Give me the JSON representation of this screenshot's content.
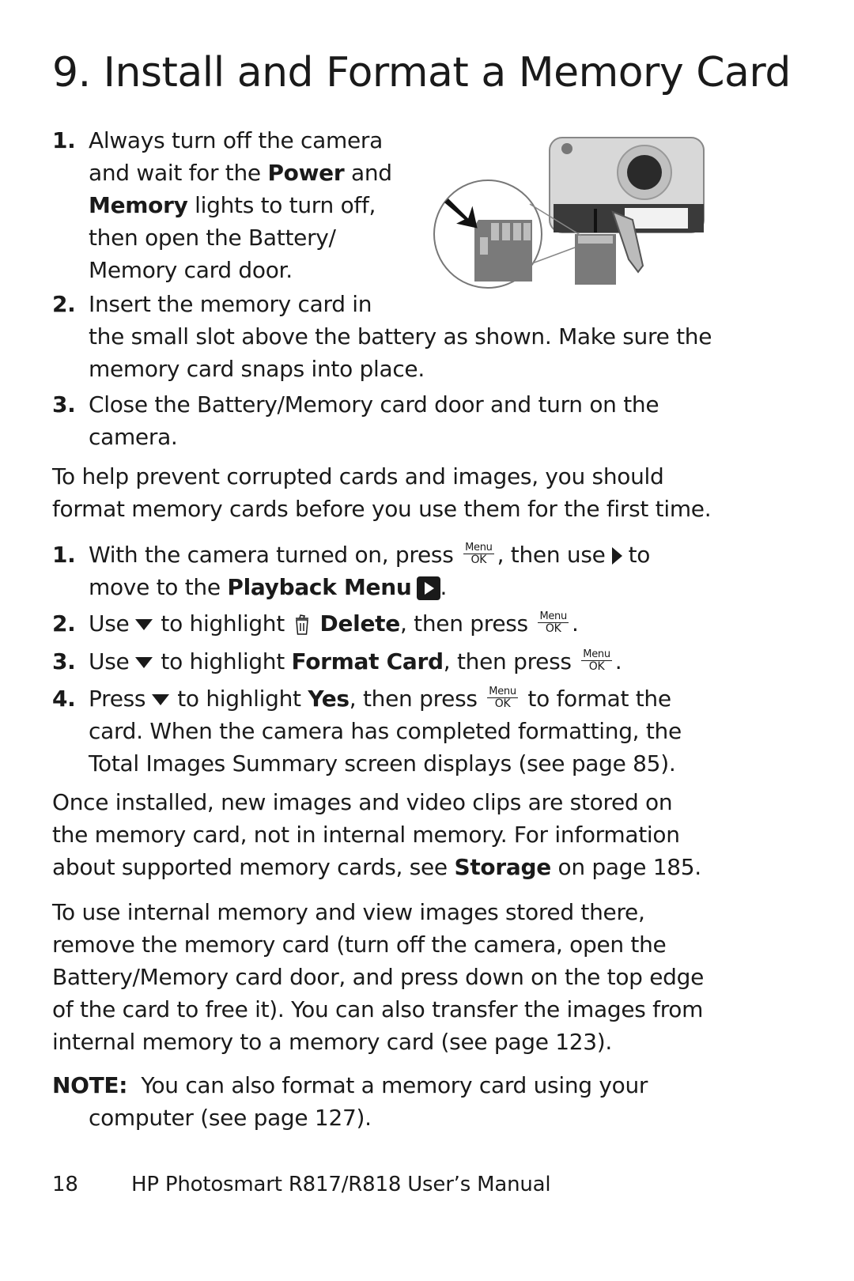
{
  "title": "9.  Install and Format a Memory Card",
  "install_steps": [
    {
      "num": "1.",
      "lines": [
        "Always turn off the camera",
        "and wait for the ",
        "Power",
        " and",
        "Memory",
        " lights to turn off,",
        "then open the Battery/",
        "Memory card door."
      ]
    },
    {
      "num": "2.",
      "line1": "Insert the memory card in",
      "line2": "the small slot above the battery as shown. Make sure the",
      "line3": "memory card snaps into place."
    },
    {
      "num": "3.",
      "line1": "Close the Battery/Memory card door and turn on the",
      "line2": "camera."
    }
  ],
  "intro_paragraph": [
    "To help prevent corrupted cards and images, you should",
    "format memory cards before you use them for the first time."
  ],
  "format_steps": {
    "s1": {
      "num": "1.",
      "a": "With the camera turned on, press",
      "b": ", then use",
      "c": "to",
      "d": "move to the ",
      "bold": "Playback Menu",
      "end": "."
    },
    "s2": {
      "num": "2.",
      "a": "Use",
      "b": "to highlight",
      "bold": "Delete",
      "c": ", then press",
      "end": "."
    },
    "s3": {
      "num": "3.",
      "a": "Use",
      "b": "to highlight ",
      "bold": "Format Card",
      "c": ", then press",
      "end": "."
    },
    "s4": {
      "num": "4.",
      "a": "Press",
      "b": "to highlight ",
      "bold": "Yes",
      "c": ", then press",
      "d": "to format the",
      "line2": "card. When the camera has completed formatting, the",
      "line3": "Total Images Summary screen displays (see page 85)."
    }
  },
  "menu_ok": {
    "top": "Menu",
    "bottom": "OK"
  },
  "installed_paragraph": {
    "l1": "Once installed, new images and video clips are stored on",
    "l2": "the memory card, not in internal memory. For information",
    "l3a": "about supported memory cards, see ",
    "l3bold": "Storage",
    "l3b": " on page 185."
  },
  "internal_paragraph": [
    "To use internal memory and view images stored there,",
    "remove the memory card (turn off the camera, open the",
    "Battery/Memory card door, and press down on the top edge",
    "of the card to free it). You can also transfer the images from",
    "internal memory to a memory card (see page 123)."
  ],
  "note": {
    "label": "NOTE:",
    "l1": "  You can also format a memory card using your",
    "l2": "computer (see page 127)."
  },
  "footer": {
    "page": "18",
    "manual": "HP Photosmart R817/R818 User’s Manual"
  },
  "illustration_alt": "Camera with open battery/memory card door and memory card being inserted"
}
